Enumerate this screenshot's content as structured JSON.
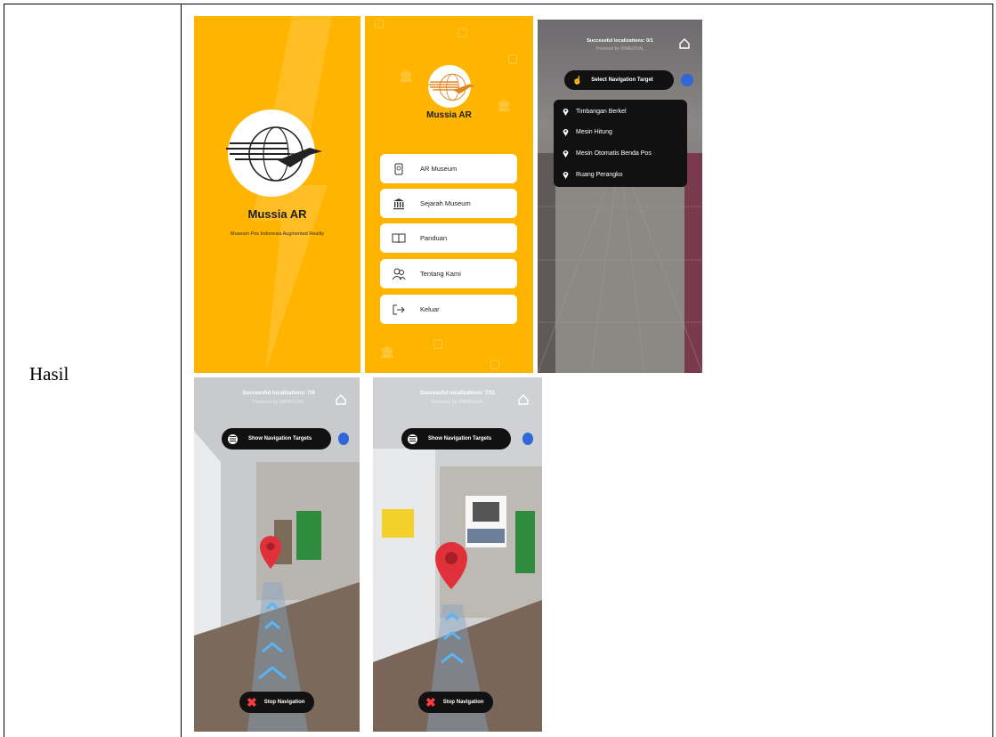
{
  "row_label": "Hasil",
  "splash": {
    "title": "Mussia AR",
    "subtitle": "Museum Pos Indonesia Augmented Reality"
  },
  "menu": {
    "title": "Mussia AR",
    "items": [
      {
        "label": "AR Museum",
        "icon": "phone-ar-icon"
      },
      {
        "label": "Sejarah Museum",
        "icon": "museum-icon"
      },
      {
        "label": "Panduan",
        "icon": "book-icon"
      },
      {
        "label": "Tentang Kami",
        "icon": "people-icon"
      },
      {
        "label": "Keluar",
        "icon": "logout-icon"
      }
    ]
  },
  "ar_select": {
    "status": "Successful localizations: 0/1",
    "powered": "Powered by IMMERSAL",
    "select_label": "Select Navigation Target",
    "targets": [
      "Timbangan Berkel",
      "Mesin Hitung",
      "Mesin Otomatis Benda Pos",
      "Ruang Perangko"
    ]
  },
  "ar_nav_1": {
    "status": "Successful localizations: 7/8",
    "powered": "Powered by IMMERSAL",
    "show_label": "Show Navigation Targets",
    "stop_label": "Stop Navigation"
  },
  "ar_nav_2": {
    "status": "Successful localizations: 7/11",
    "powered": "Powered by IMMERSAL",
    "show_label": "Show Navigation Targets",
    "stop_label": "Stop Navigation"
  },
  "colors": {
    "brand_yellow": "#FFB400",
    "pin_red": "#E0313B",
    "path_blue": "#5AB4F5"
  }
}
